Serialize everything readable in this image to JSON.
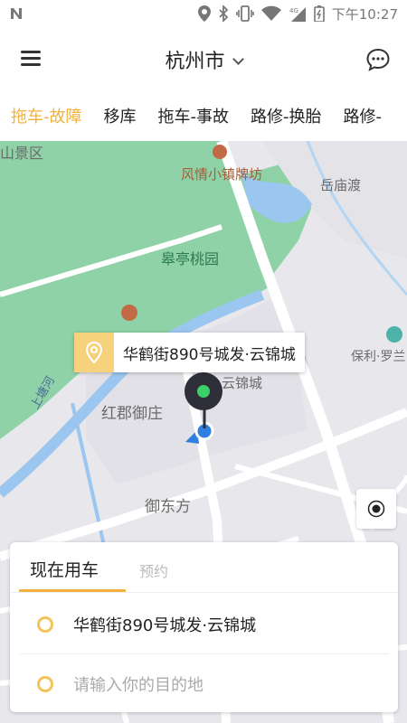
{
  "status_bar": {
    "time": "下午10:27",
    "icons": [
      "notification-n-icon",
      "location-icon",
      "bluetooth-icon",
      "vibrate-icon",
      "wifi-icon",
      "signal-4g-icon",
      "battery-icon"
    ]
  },
  "header": {
    "city": "杭州市",
    "menu_icon": "menu-icon",
    "message_icon": "message-icon"
  },
  "tabs": [
    {
      "label": "拖车-故障",
      "active": true
    },
    {
      "label": "移库",
      "active": false
    },
    {
      "label": "拖车-事故",
      "active": false
    },
    {
      "label": "路修-换胎",
      "active": false
    },
    {
      "label": "路修-",
      "active": false
    }
  ],
  "map": {
    "labels": {
      "scenic": "山景区",
      "fengqing": "风情小镇牌坊",
      "yuemiaodu": "岳庙渡",
      "gaoting": "皋亭桃园",
      "baoli": "保利·罗兰",
      "yunjincheng": "云锦城",
      "hongjun": "红郡御庄",
      "shangtanghe": "上塘河",
      "yudongfang": "御东方"
    },
    "current_address": "华鹤街890号城发·云锦城"
  },
  "panel": {
    "tab_now": "现在用车",
    "tab_book": "预约",
    "from": "华鹤街890号城发·云锦城",
    "to_placeholder": "请输入你的目的地"
  },
  "colors": {
    "accent": "#f0b23c",
    "park_green": "#8fd2a7",
    "water_blue": "#9bc6ef"
  }
}
